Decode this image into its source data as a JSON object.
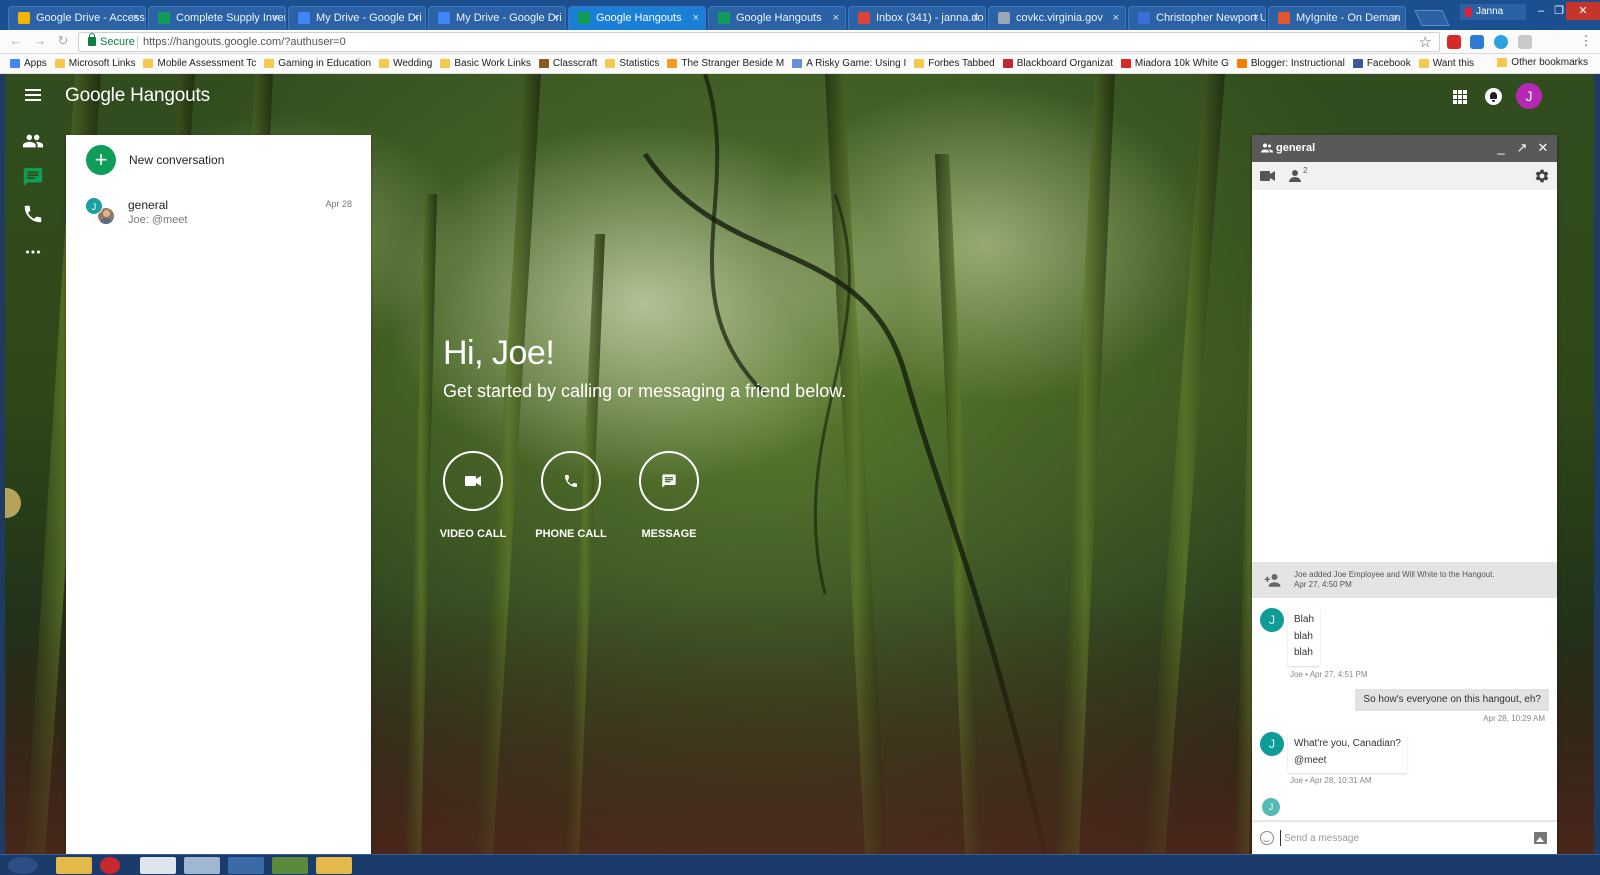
{
  "browser": {
    "tabs": [
      {
        "title": "Google Drive - Access",
        "favicon_color": "#f4b400"
      },
      {
        "title": "Complete Supply Inven",
        "favicon_color": "#0f9d58"
      },
      {
        "title": "My Drive - Google Dri",
        "favicon_color": "#4285f4"
      },
      {
        "title": "My Drive - Google Dri",
        "favicon_color": "#4285f4"
      },
      {
        "title": "Google Hangouts",
        "favicon_color": "#0f9d58",
        "active": true
      },
      {
        "title": "Google Hangouts",
        "favicon_color": "#0f9d58"
      },
      {
        "title": "Inbox (341) - janna.do",
        "favicon_color": "#db4437"
      },
      {
        "title": "covkc.virginia.gov",
        "favicon_color": "#9aa7b5"
      },
      {
        "title": "Christopher Newport U",
        "favicon_color": "#3b6fd8"
      },
      {
        "title": "MyIgnite - On Deman",
        "favicon_color": "#e4572e"
      }
    ],
    "tab_close_glyph": "×",
    "profile_name": "Janna",
    "window_controls": {
      "minimize": "–",
      "restore": "❐",
      "close": "✕"
    },
    "secure_label": "Secure",
    "url": "https://hangouts.google.com/?authuser=0",
    "bookmarks": [
      {
        "label": "Apps",
        "icon_color": "#4285f4"
      },
      {
        "label": "Microsoft Links",
        "icon_color": "#f5c850"
      },
      {
        "label": "Mobile Assessment Tc",
        "icon_color": "#f5c850"
      },
      {
        "label": "Gaming in Education",
        "icon_color": "#f5c850"
      },
      {
        "label": "Wedding",
        "icon_color": "#f5c850"
      },
      {
        "label": "Basic Work Links",
        "icon_color": "#f5c850"
      },
      {
        "label": "Classcraft",
        "icon_color": "#8a5a20"
      },
      {
        "label": "Statistics",
        "icon_color": "#f5c850"
      },
      {
        "label": "The Stranger Beside M",
        "icon_color": "#f29b1d"
      },
      {
        "label": "A Risky Game: Using I",
        "icon_color": "#6b8fd6"
      },
      {
        "label": "Forbes Tabbed",
        "icon_color": "#f5c850"
      },
      {
        "label": "Blackboard Organizat",
        "icon_color": "#c4262e"
      },
      {
        "label": "Miadora 10k White G",
        "icon_color": "#d62a2a"
      },
      {
        "label": "Blogger: Instructional",
        "icon_color": "#f57d00"
      },
      {
        "label": "Facebook",
        "icon_color": "#3b5998"
      },
      {
        "label": "Want this",
        "icon_color": "#f5c850"
      }
    ],
    "other_bookmarks": "Other bookmarks"
  },
  "app": {
    "brand": "Google Hangouts",
    "account_initial": "J",
    "account_color": "#b629b4",
    "rail": [
      {
        "name": "contacts-icon"
      },
      {
        "name": "messages-icon",
        "active": true
      },
      {
        "name": "phone-icon"
      },
      {
        "name": "more-icon"
      }
    ]
  },
  "conversations": {
    "new_label": "New conversation",
    "items": [
      {
        "title": "general",
        "snippet": "Joe: @meet",
        "date": "Apr 28",
        "avatar_initial": "J"
      }
    ]
  },
  "greeting": {
    "title": "Hi, Joe!",
    "subtitle": "Get started by calling or messaging a friend below.",
    "actions": [
      {
        "label": "VIDEO CALL",
        "icon": "video-camera-icon"
      },
      {
        "label": "PHONE CALL",
        "icon": "phone-icon"
      },
      {
        "label": "MESSAGE",
        "icon": "message-icon"
      }
    ]
  },
  "chat": {
    "title": "general",
    "members_count": "2",
    "system_message": "Joe added Joe Employee and Will White to the Hangout.",
    "system_time": "Apr 27, 4:50 PM",
    "messages": [
      {
        "from": "Joe",
        "initial": "J",
        "lines": [
          "Blah",
          "blah",
          "blah"
        ],
        "meta": "Joe • Apr 27, 4:51 PM",
        "outgoing": false
      },
      {
        "from": "me",
        "lines": [
          "So how's everyone on this hangout, eh?"
        ],
        "meta": "Apr 28, 10:29 AM",
        "outgoing": true
      },
      {
        "from": "Joe",
        "initial": "J",
        "lines": [
          "What're you, Canadian?",
          "@meet"
        ],
        "meta": "Joe • Apr 28, 10:31 AM",
        "outgoing": false
      }
    ],
    "typing_initial": "J",
    "input_placeholder": "Send a message",
    "input_value": ""
  }
}
